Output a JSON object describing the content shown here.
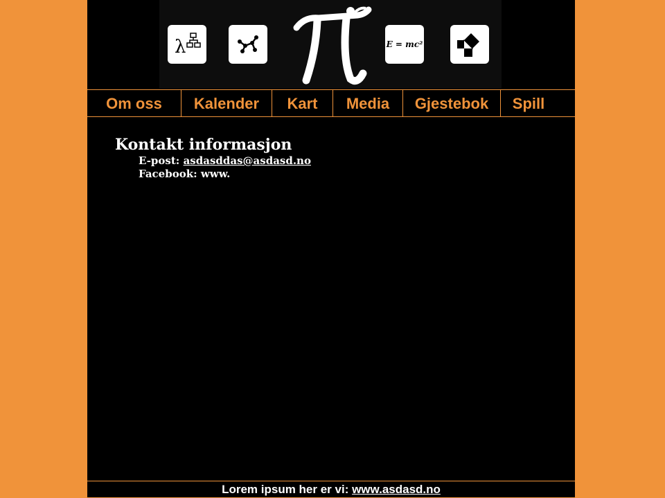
{
  "banner": {
    "icons": [
      "lambda-flowchart-icon",
      "molecule-graph-icon",
      "pi-figure-logo",
      "e-equals-mc2-icon",
      "pythagoras-squares-icon"
    ],
    "emc2_text": "E = mc²"
  },
  "nav": {
    "items": [
      {
        "label": "Om oss"
      },
      {
        "label": "Kalender"
      },
      {
        "label": "Kart"
      },
      {
        "label": "Media"
      },
      {
        "label": "Gjestebok"
      },
      {
        "label": "Spill"
      }
    ]
  },
  "contact": {
    "title": "Kontakt informasjon",
    "email_label": "E-post: ",
    "email": "asdasddas@asdasd.no",
    "facebook_label": "Facebook: ",
    "facebook": "www."
  },
  "footer": {
    "text": "Lorem ipsum her er vi: ",
    "link": "www.asdasd.no"
  },
  "colors": {
    "background": "#f0933a",
    "accent": "#f0933a",
    "page": "#000000",
    "text": "#ffffff"
  }
}
